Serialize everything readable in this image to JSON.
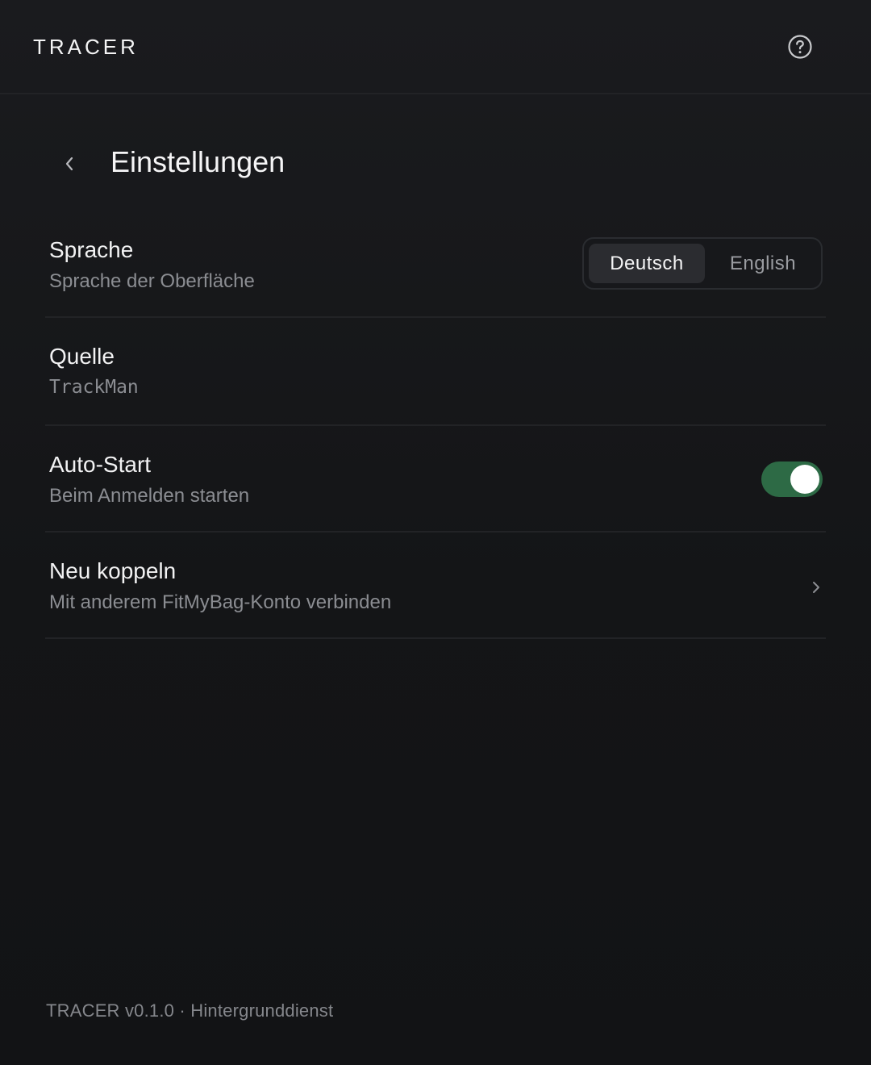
{
  "app": {
    "brand": "TRACER"
  },
  "header": {
    "title": "Einstellungen"
  },
  "settings": {
    "language": {
      "label": "Sprache",
      "description": "Sprache der Oberfläche",
      "options": [
        "Deutsch",
        "English"
      ],
      "selected": "Deutsch"
    },
    "source": {
      "label": "Quelle",
      "value": "TrackMan"
    },
    "autostart": {
      "label": "Auto-Start",
      "description": "Beim Anmelden starten",
      "enabled": true
    },
    "repair": {
      "label": "Neu koppeln",
      "description": "Mit anderem FitMyBag-Konto verbinden"
    }
  },
  "footer": {
    "text": "TRACER v0.1.0 · Hintergrunddienst"
  },
  "colors": {
    "accent_toggle": "#2d6a45",
    "background": "#141517"
  },
  "icons": {
    "help": "help-circle-icon",
    "back": "chevron-left-icon",
    "forward": "chevron-right-icon"
  }
}
